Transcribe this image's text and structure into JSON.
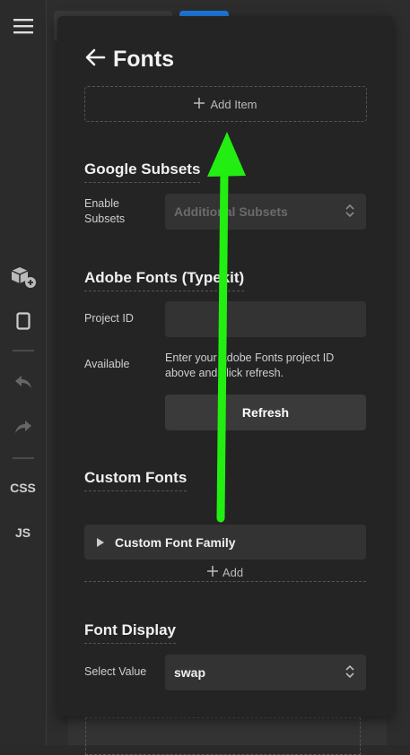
{
  "toolbar": {
    "css_label": "CSS",
    "js_label": "JS"
  },
  "panel": {
    "title": "Fonts",
    "add_item_label": "Add Item"
  },
  "google_subsets": {
    "title": "Google Subsets",
    "enable_label": "Enable Subsets",
    "select_value": "Additional Subsets"
  },
  "adobe_fonts": {
    "title": "Adobe Fonts (Typekit)",
    "project_id_label": "Project ID",
    "project_id_value": "",
    "available_label": "Available",
    "help_text": "Enter your Adobe Fonts project ID above and click refresh.",
    "refresh_label": "Refresh"
  },
  "custom_fonts": {
    "title": "Custom Fonts",
    "items": [
      {
        "label": "Custom Font Family"
      }
    ],
    "add_label": "Add"
  },
  "font_display": {
    "title": "Font Display",
    "select_label": "Select Value",
    "select_value": "swap"
  },
  "overlay": {
    "arrow_color": "#22ee11"
  }
}
